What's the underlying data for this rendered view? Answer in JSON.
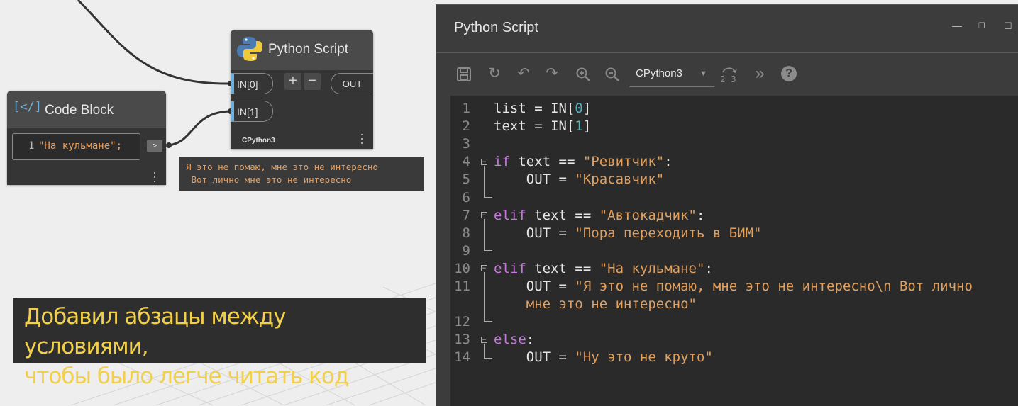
{
  "python_node": {
    "title": "Python Script",
    "inputs": [
      "IN[0]",
      "IN[1]"
    ],
    "add_label": "+",
    "remove_label": "−",
    "output": "OUT",
    "engine": "CPython3"
  },
  "code_block_node": {
    "title": "Code Block",
    "icon_glyph": "[</]",
    "line_number": "1",
    "code": "\"На кульмане\";",
    "output_arrow": ">"
  },
  "preview": {
    "line1": "Я это не помаю, мне это не интересно",
    "line2": " Вот лично мне это не интересно"
  },
  "caption": {
    "line1": "Добавил абзацы между условиями,",
    "line2": "чтобы было легче читать код"
  },
  "editor": {
    "title": "Python Script",
    "engine_selected": "CPython3",
    "toolbar_icons": [
      "save-icon",
      "run-icon",
      "undo-icon",
      "redo-icon",
      "zoom-in-icon",
      "zoom-out-icon",
      "convert-icon",
      "more-icon",
      "help-icon"
    ],
    "lines": [
      {
        "n": "1",
        "tokens": [
          [
            "",
            "list = IN["
          ],
          [
            "num",
            "0"
          ],
          [
            "",
            "]"
          ]
        ]
      },
      {
        "n": "2",
        "tokens": [
          [
            "",
            "text = IN["
          ],
          [
            "num",
            "1"
          ],
          [
            "",
            "]"
          ]
        ]
      },
      {
        "n": "3",
        "tokens": []
      },
      {
        "n": "4",
        "tokens": [
          [
            "kw",
            "if"
          ],
          [
            "",
            " text == "
          ],
          [
            "str",
            "\"Ревитчик\""
          ],
          [
            "",
            ":"
          ]
        ]
      },
      {
        "n": "5",
        "tokens": [
          [
            "",
            "    OUT = "
          ],
          [
            "str",
            "\"Красавчик\""
          ]
        ]
      },
      {
        "n": "6",
        "tokens": []
      },
      {
        "n": "7",
        "tokens": [
          [
            "kw",
            "elif"
          ],
          [
            "",
            " text == "
          ],
          [
            "str",
            "\"Автокадчик\""
          ],
          [
            "",
            ":"
          ]
        ]
      },
      {
        "n": "8",
        "tokens": [
          [
            "",
            "    OUT = "
          ],
          [
            "str",
            "\"Пора переходить в БИМ\""
          ]
        ]
      },
      {
        "n": "9",
        "tokens": []
      },
      {
        "n": "10",
        "tokens": [
          [
            "kw",
            "elif"
          ],
          [
            "",
            " text == "
          ],
          [
            "str",
            "\"На кульмане\""
          ],
          [
            "",
            ":"
          ]
        ]
      },
      {
        "n": "11",
        "tokens": [
          [
            "",
            "    OUT = "
          ],
          [
            "str",
            "\"Я это не помаю, мне это не интересно\\n Вот лично"
          ]
        ]
      },
      {
        "n": "",
        "tokens": [
          [
            "str",
            "    мне это не интересно\""
          ]
        ]
      },
      {
        "n": "12",
        "tokens": []
      },
      {
        "n": "13",
        "tokens": [
          [
            "kw",
            "else"
          ],
          [
            "",
            ":"
          ]
        ]
      },
      {
        "n": "14",
        "tokens": [
          [
            "",
            "    OUT = "
          ],
          [
            "str",
            "\"Ну это не круто\""
          ]
        ]
      }
    ]
  },
  "colors": {
    "canvas": "#eeeeee",
    "node": "#353535",
    "port_accent": "#6ab0de",
    "string": "#e0a060",
    "keyword": "#c678dd",
    "number": "#56b6c2",
    "caption_text": "#f2d04a"
  }
}
